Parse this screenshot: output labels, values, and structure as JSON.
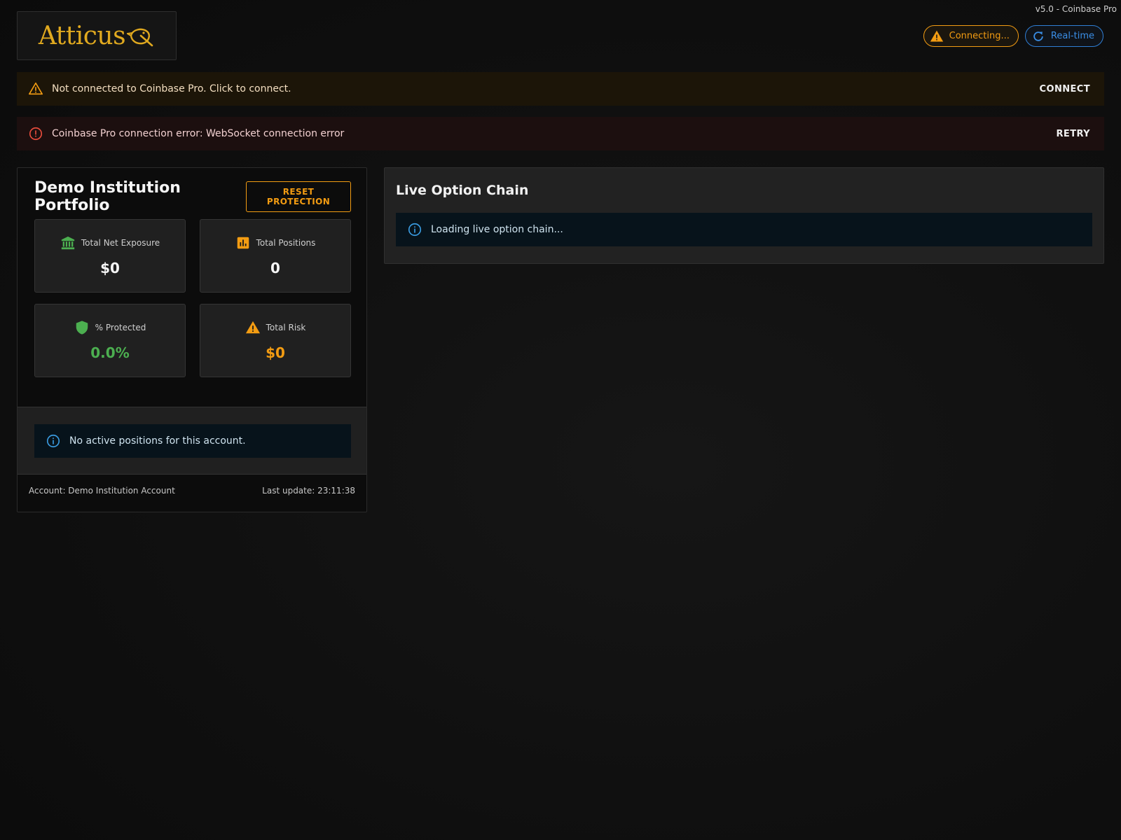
{
  "header": {
    "version_text": "v5.0 - Coinbase Pro",
    "logo_text": "Atticus",
    "chips": {
      "connecting_label": "Connecting...",
      "realtime_label": "Real-time"
    }
  },
  "alerts": {
    "warning": {
      "message": "Not connected to Coinbase Pro. Click to connect.",
      "action": "CONNECT"
    },
    "error": {
      "message": "Coinbase Pro connection error: WebSocket connection error",
      "action": "RETRY"
    }
  },
  "portfolio": {
    "title": "Demo Institution Portfolio",
    "reset_label": "RESET PROTECTION",
    "stats": {
      "net_exposure": {
        "label": "Total Net Exposure",
        "value": "$0",
        "icon": "bank-icon"
      },
      "positions": {
        "label": "Total Positions",
        "value": "0",
        "icon": "bar-chart-icon"
      },
      "protected": {
        "label": "% Protected",
        "value": "0.0%",
        "icon": "shield-icon"
      },
      "risk": {
        "label": "Total Risk",
        "value": "$0",
        "icon": "warning-icon"
      }
    },
    "empty_message": "No active positions for this account.",
    "footer": {
      "account": "Account: Demo Institution Account",
      "last_update": "Last update: 23:11:38"
    }
  },
  "option_chain": {
    "title": "Live Option Chain",
    "loading_message": "Loading live option chain..."
  },
  "colors": {
    "brand_gold": "#e0a91f",
    "warning_orange": "#f39c12",
    "error_red": "#e74c3c",
    "info_blue": "#3a8ee6",
    "success_green": "#4caf50"
  }
}
